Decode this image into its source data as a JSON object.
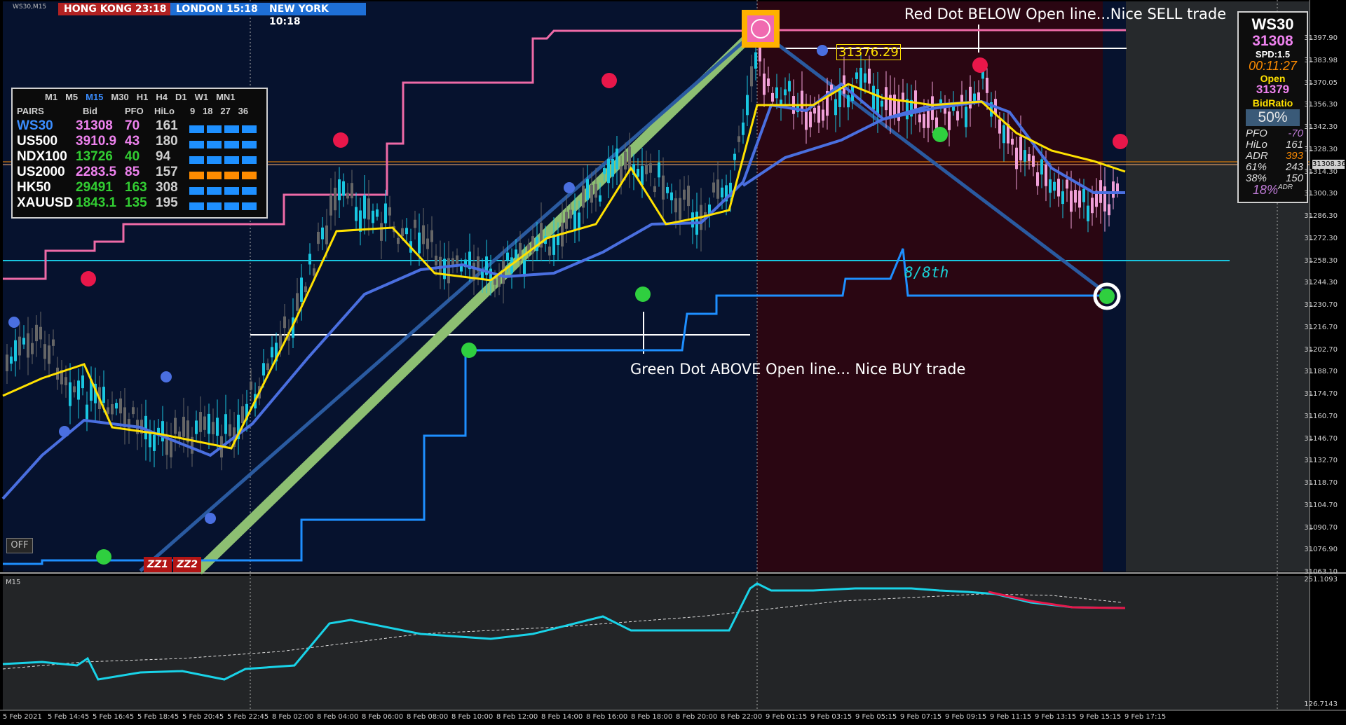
{
  "chart_window": {
    "symbol_label": "WS30,M15",
    "sub_window_label": "M15"
  },
  "clocks": [
    {
      "label": "HONG KONG 23:18",
      "color": "#b22222"
    },
    {
      "label": "LONDON   15:18",
      "color": "#1e6fd6"
    },
    {
      "label": "NEW YORK  10:18",
      "color": "#1e6fd6"
    }
  ],
  "pairs_panel": {
    "timeframes": [
      "M1",
      "M5",
      "M15",
      "M30",
      "H1",
      "H4",
      "D1",
      "W1",
      "MN1"
    ],
    "active_timeframe": "M15",
    "headers": {
      "pairs": "PAIRS",
      "bid": "Bid",
      "pfo": "PFO",
      "hilo": "HiLo",
      "periods": "9   18   27   36"
    },
    "rows": [
      {
        "pair": "WS30",
        "bid": "31308",
        "pfo": "70",
        "hilo": "161",
        "pair_color": "#3a8dff",
        "bid_color": "#ee82ee",
        "pfo_color": "#ee82ee",
        "bar_color": "#1e90ff"
      },
      {
        "pair": "US500",
        "bid": "3910.9",
        "pfo": "43",
        "hilo": "180",
        "pair_color": "#ffffff",
        "bid_color": "#ee82ee",
        "pfo_color": "#ee82ee",
        "bar_color": "#1e90ff"
      },
      {
        "pair": "NDX100",
        "bid": "13726",
        "pfo": "40",
        "hilo": "94",
        "pair_color": "#ffffff",
        "bid_color": "#32cd32",
        "pfo_color": "#32cd32",
        "bar_color": "#1e90ff"
      },
      {
        "pair": "US2000",
        "bid": "2283.5",
        "pfo": "85",
        "hilo": "157",
        "pair_color": "#ffffff",
        "bid_color": "#ee82ee",
        "pfo_color": "#ee82ee",
        "bar_color": "#ff8c00"
      },
      {
        "pair": "HK50",
        "bid": "29491",
        "pfo": "163",
        "hilo": "308",
        "pair_color": "#ffffff",
        "bid_color": "#32cd32",
        "pfo_color": "#32cd32",
        "bar_color": "#1e90ff"
      },
      {
        "pair": "XAUUSD",
        "bid": "1843.1",
        "pfo": "135",
        "hilo": "195",
        "pair_color": "#ffffff",
        "bid_color": "#32cd32",
        "pfo_color": "#32cd32",
        "bar_color": "#1e90ff"
      }
    ]
  },
  "info_panel": {
    "symbol": "WS30",
    "price": "31308",
    "spread": "SPD:1.5",
    "timer": "00:11:27",
    "open_label": "Open",
    "open_value": "31379",
    "bid_ratio_label": "BidRatio",
    "bid_ratio_value": "50%",
    "stats": [
      {
        "k": "PFO",
        "v": "-70",
        "color": "#c07cd8"
      },
      {
        "k": "HiLo",
        "v": "161",
        "color": "#dddddd"
      },
      {
        "k": "ADR",
        "v": "393",
        "color": "#ff8c00"
      },
      {
        "k": "61%",
        "v": "243",
        "color": "#dddddd"
      },
      {
        "k": "38%",
        "v": "150",
        "color": "#dddddd"
      }
    ],
    "adr_pct": "18%",
    "adr_suffix": "ADR"
  },
  "annotations": {
    "sell_text": "Red Dot BELOW Open line...Nice SELL trade",
    "buy_text": "Green Dot ABOVE Open line... Nice BUY trade",
    "price_tag": "31376.29",
    "eighth_label": "8/8th",
    "zz1": "ZZ1",
    "zz2": "ZZ2",
    "off_button": "OFF",
    "current_price_marker": "31308.36"
  },
  "y_axis": [
    "31397.90",
    "31383.98",
    "31370.05",
    "31356.30",
    "31342.30",
    "31328.30",
    "31314.30",
    "31300.30",
    "31286.30",
    "31272.30",
    "31258.30",
    "31244.30",
    "31230.70",
    "31216.70",
    "31202.70",
    "31188.70",
    "31174.70",
    "31160.70",
    "31146.70",
    "31132.70",
    "31118.70",
    "31104.70",
    "31090.70",
    "31076.90",
    "31063.10"
  ],
  "sub_y_axis": {
    "top": "251.1093",
    "bottom": "126.7143"
  },
  "x_axis": [
    "5 Feb 2021",
    "5 Feb 14:45",
    "5 Feb 16:45",
    "5 Feb 18:45",
    "5 Feb 20:45",
    "5 Feb 22:45",
    "8 Feb 02:00",
    "8 Feb 04:00",
    "8 Feb 06:00",
    "8 Feb 08:00",
    "8 Feb 10:00",
    "8 Feb 12:00",
    "8 Feb 14:00",
    "8 Feb 16:00",
    "8 Feb 18:00",
    "8 Feb 20:00",
    "8 Feb 22:00",
    "9 Feb 01:15",
    "9 Feb 03:15",
    "9 Feb 05:15",
    "9 Feb 07:15",
    "9 Feb 09:15",
    "9 Feb 11:15",
    "9 Feb 13:15",
    "9 Feb 15:15",
    "9 Feb 17:15"
  ],
  "colors": {
    "background": "#000000",
    "main_bg": "#06122e",
    "session_bg": "#2a0612",
    "sub_bg": "#232527",
    "bull": "#19c6e0",
    "bear": "#666666",
    "bear_session": "#f0a0d8",
    "ma_fast": "#ffe100",
    "ma_slow": "#4a6fe0",
    "envelope_upper": "#ee6aa7",
    "envelope_lower": "#1e8fff",
    "hline_cyan": "#19c6e0",
    "trend_green": "#8dbf72",
    "trend_blue": "#2a5aa0"
  }
}
